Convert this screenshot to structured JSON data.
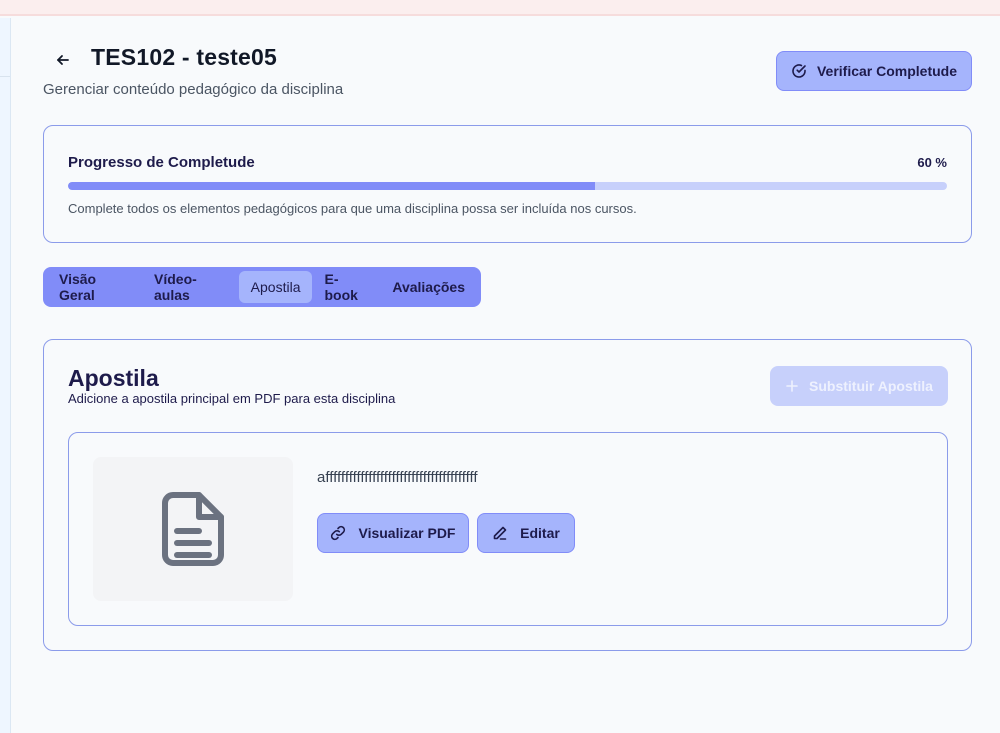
{
  "header": {
    "title": "TES102 - teste05",
    "subtitle": "Gerenciar conteúdo pedagógico da disciplina",
    "verify_label": "Verificar Completude"
  },
  "progress": {
    "title": "Progresso de Completude",
    "value_label": "60 %",
    "value": 0.6,
    "hint": "Complete todos os elementos pedagógicos para que uma disciplina possa ser incluída nos cursos."
  },
  "tabs": [
    {
      "label": "Visão Geral",
      "active": false
    },
    {
      "label": "Vídeo-aulas",
      "active": false
    },
    {
      "label": "Apostila",
      "active": true
    },
    {
      "label": "E-book",
      "active": false
    },
    {
      "label": "Avaliações",
      "active": false
    }
  ],
  "section": {
    "title": "Apostila",
    "description": "Adicione a apostila principal em PDF para esta disciplina",
    "replace_label": "Substituir Apostila"
  },
  "file": {
    "name": "afffffffffffffffffffffffffffffffffffffff",
    "view_label": "Visualizar PDF",
    "edit_label": "Editar"
  },
  "icons": {
    "back": "arrow-left-icon",
    "verify": "check-circle-icon",
    "replace": "plus-icon",
    "thumb": "file-text-icon",
    "view": "link-icon",
    "edit": "pencil-icon"
  },
  "colors": {
    "accent": "#818cf8",
    "accent_light": "#a5b4fc",
    "accent_faded": "#c7d0fb",
    "text_dark": "#1e1b4b"
  }
}
